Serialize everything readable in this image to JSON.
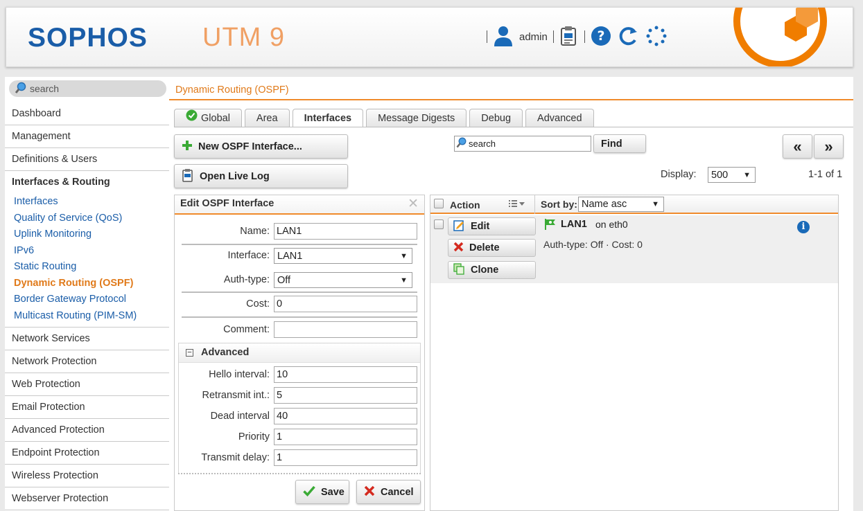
{
  "header": {
    "logo": "SOPHOS",
    "product": "UTM 9",
    "user": "admin",
    "icons": [
      "user-icon",
      "clipboard-icon",
      "help-icon",
      "reload-icon",
      "spinner-icon"
    ]
  },
  "sidebar": {
    "search_placeholder": "search",
    "items": [
      {
        "label": "Dashboard"
      },
      {
        "label": "Management"
      },
      {
        "label": "Definitions & Users"
      },
      {
        "label": "Interfaces & Routing"
      }
    ],
    "sub_items": [
      {
        "label": "Interfaces"
      },
      {
        "label": "Quality of Service (QoS)"
      },
      {
        "label": "Uplink Monitoring"
      },
      {
        "label": "IPv6"
      },
      {
        "label": "Static Routing"
      },
      {
        "label": "Dynamic Routing (OSPF)"
      },
      {
        "label": "Border Gateway Protocol"
      },
      {
        "label": "Multicast Routing (PIM-SM)"
      }
    ],
    "items_after": [
      {
        "label": "Network Services"
      },
      {
        "label": "Network Protection"
      },
      {
        "label": "Web Protection"
      },
      {
        "label": "Email Protection"
      },
      {
        "label": "Advanced Protection"
      },
      {
        "label": "Endpoint Protection"
      },
      {
        "label": "Wireless Protection"
      },
      {
        "label": "Webserver Protection"
      }
    ]
  },
  "main": {
    "title": "Dynamic Routing (OSPF)",
    "tabs": [
      {
        "label": "Global"
      },
      {
        "label": "Area"
      },
      {
        "label": "Interfaces"
      },
      {
        "label": "Message Digests"
      },
      {
        "label": "Debug"
      },
      {
        "label": "Advanced"
      }
    ],
    "new_button": "New OSPF Interface...",
    "live_log_button": "Open Live Log",
    "search_placeholder": "search",
    "find_button": "Find",
    "prev_page": "«",
    "next_page": "»",
    "display_label": "Display:",
    "display_value": "500",
    "pager_info": "1-1 of 1"
  },
  "edit": {
    "title": "Edit OSPF Interface",
    "close": "✕",
    "name_label": "Name:",
    "name_value": "LAN1",
    "interface_label": "Interface:",
    "interface_value": "LAN1",
    "authtype_label": "Auth-type:",
    "authtype_value": "Off",
    "cost_label": "Cost:",
    "cost_value": "0",
    "comment_label": "Comment:",
    "comment_value": "",
    "advanced_title": "Advanced",
    "advanced_toggle": "−",
    "hello_label": "Hello interval:",
    "hello_value": "10",
    "retransmit_label": "Retransmit int.:",
    "retransmit_value": "5",
    "dead_label": "Dead interval",
    "dead_value": "40",
    "priority_label": "Priority",
    "priority_value": "1",
    "transmit_label": "Transmit delay:",
    "transmit_value": "1",
    "save": "Save",
    "cancel": "Cancel"
  },
  "list": {
    "action_header": "Action",
    "sortby_label": "Sort by:",
    "sortby_value": "Name asc",
    "row": {
      "name": "LAN1",
      "on": "on eth0",
      "details": "Auth-type: Off · Cost: 0",
      "edit": "Edit",
      "delete": "Delete",
      "clone": "Clone"
    }
  },
  "colors": {
    "accent": "#f08a2a",
    "brand_blue": "#1a5da8",
    "link": "#1a5da8",
    "current": "#e07a1a"
  }
}
